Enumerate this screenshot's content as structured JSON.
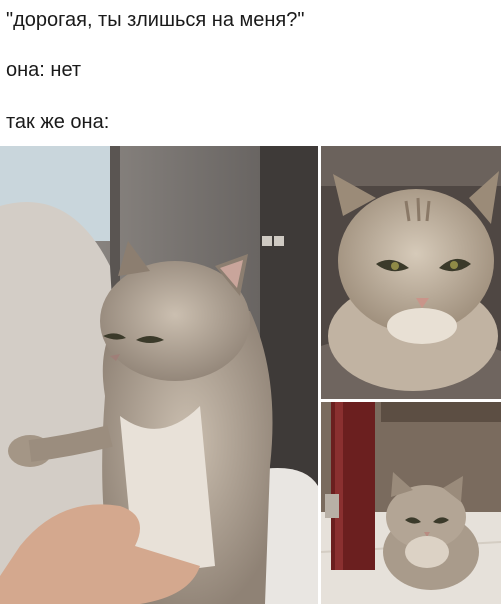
{
  "caption": {
    "line1": "\"дорогая, ты злишься на меня?\"",
    "line2": "она: нет",
    "line3": "так же она:"
  },
  "photos": [
    {
      "subject": "grumpy-cat-held-icon"
    },
    {
      "subject": "angry-cat-closeup-icon"
    },
    {
      "subject": "cat-under-table-icon"
    }
  ],
  "colors": {
    "background": "#ffffff",
    "text": "#1a1a1a",
    "fur": "#a89a8b",
    "fur_light": "#d9cfc3",
    "eye": "#3b3a2a"
  }
}
